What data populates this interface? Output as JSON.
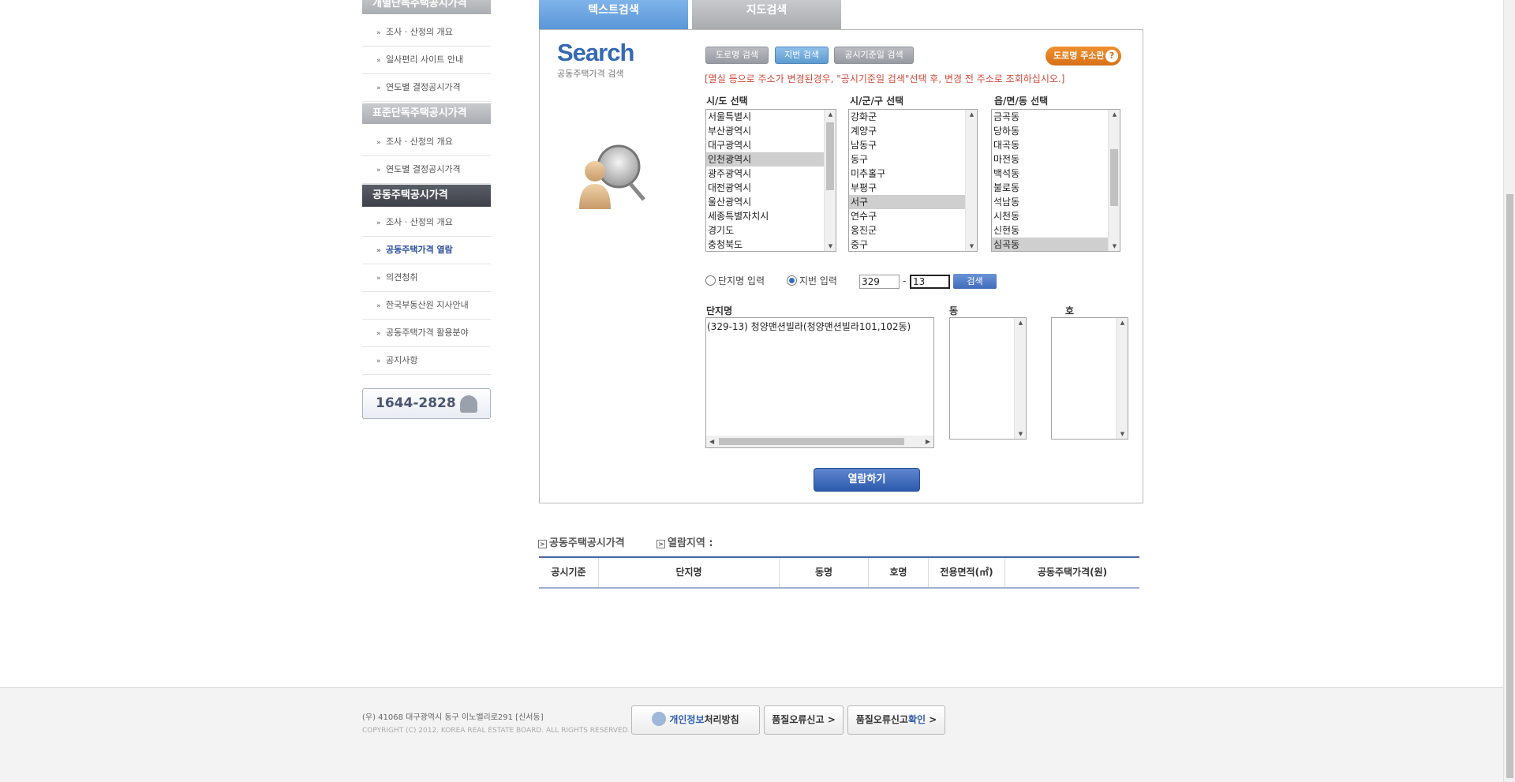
{
  "sidebar": {
    "sections": [
      {
        "title": "개별단독주택공시가격",
        "items": [
          "조사 · 산정의 개요",
          "일사편리 사이트 안내",
          "연도별 결정공시가격"
        ]
      },
      {
        "title": "표준단독주택공시가격",
        "items": [
          "조사 · 산정의 개요",
          "연도별 결정공시가격"
        ]
      },
      {
        "title": "공동주택공시가격",
        "items": [
          "조사 · 산정의 개요",
          "공동주택가격 열람",
          "의견청취",
          "한국부동산원 지사안내",
          "공동주택가격 활용분야",
          "공지사항"
        ]
      }
    ],
    "phone": "1644-2828",
    "chevron": ">"
  },
  "tabs": [
    "텍스트검색",
    "지도검색"
  ],
  "search": {
    "title": "Search",
    "subtitle": "공동주택가격 검색",
    "mode_buttons": [
      "도로명 검색",
      "지번 검색",
      "공시기준일 검색"
    ],
    "road_guide_button": "도로명 주소란",
    "road_guide_q": "?",
    "notice": "[멸실 등으로 주소가 변경된경우, \"공시기준일 검색\"선택 후, 변경 전 주소로 조회하십시오.]",
    "sido_label": "시/도 선택",
    "sido_options": [
      "서울특별시",
      "부산광역시",
      "대구광역시",
      "인천광역시",
      "광주광역시",
      "대전광역시",
      "울산광역시",
      "세종특별자치시",
      "경기도",
      "충청북도"
    ],
    "sido_selected": "인천광역시",
    "sigungu_label": "시/군/구 선택",
    "sigungu_options": [
      "강화군",
      "계양구",
      "남동구",
      "동구",
      "미추홀구",
      "부평구",
      "서구",
      "연수구",
      "옹진군",
      "중구"
    ],
    "sigungu_selected": "서구",
    "dong_label": "읍/면/동 선택",
    "dong_options": [
      "금곡동",
      "당하동",
      "대곡동",
      "마전동",
      "백석동",
      "불로동",
      "석남동",
      "시천동",
      "신현동",
      "심곡동"
    ],
    "dong_selected": "심곡동",
    "radio_complex": "단지명 입력",
    "radio_jibun": "지번 입력",
    "bunji_main": "329",
    "bunji_sep": "-",
    "bunji_sub": "13",
    "search_button": "검색",
    "complex_label": "단지명",
    "complex_results": [
      "(329-13) 청양맨션빌라(청양맨션빌라101,102동)"
    ],
    "building_label": "동",
    "unit_label": "호",
    "view_button": "열람하기"
  },
  "results": {
    "breadcrumb_1": "공동주택공시가격",
    "breadcrumb_2": "열람지역 :",
    "breadcrumb_icon": ">",
    "columns": [
      "공시기준",
      "단지명",
      "동명",
      "호명",
      "전용면적(㎡)",
      "공동주택가격(원)"
    ]
  },
  "footer": {
    "address": "(우) 41068   대구광역시 동구 이노밸리로291 [신서동]",
    "copyright": "COPYRIGHT (C) 2012. KOREA REAL ESTATE BOARD. ALL RIGHTS RESERVED.",
    "privacy_blue": "개인정보",
    "privacy_rest": "처리방침",
    "report_error": "품질오류신고",
    "report_check_a": "품질오류신고",
    "report_check_b": "확인",
    "chevron": ">"
  },
  "colors": {
    "accent": "#3569b3",
    "notice": "#d24a3a",
    "orange": "#e07a20"
  }
}
